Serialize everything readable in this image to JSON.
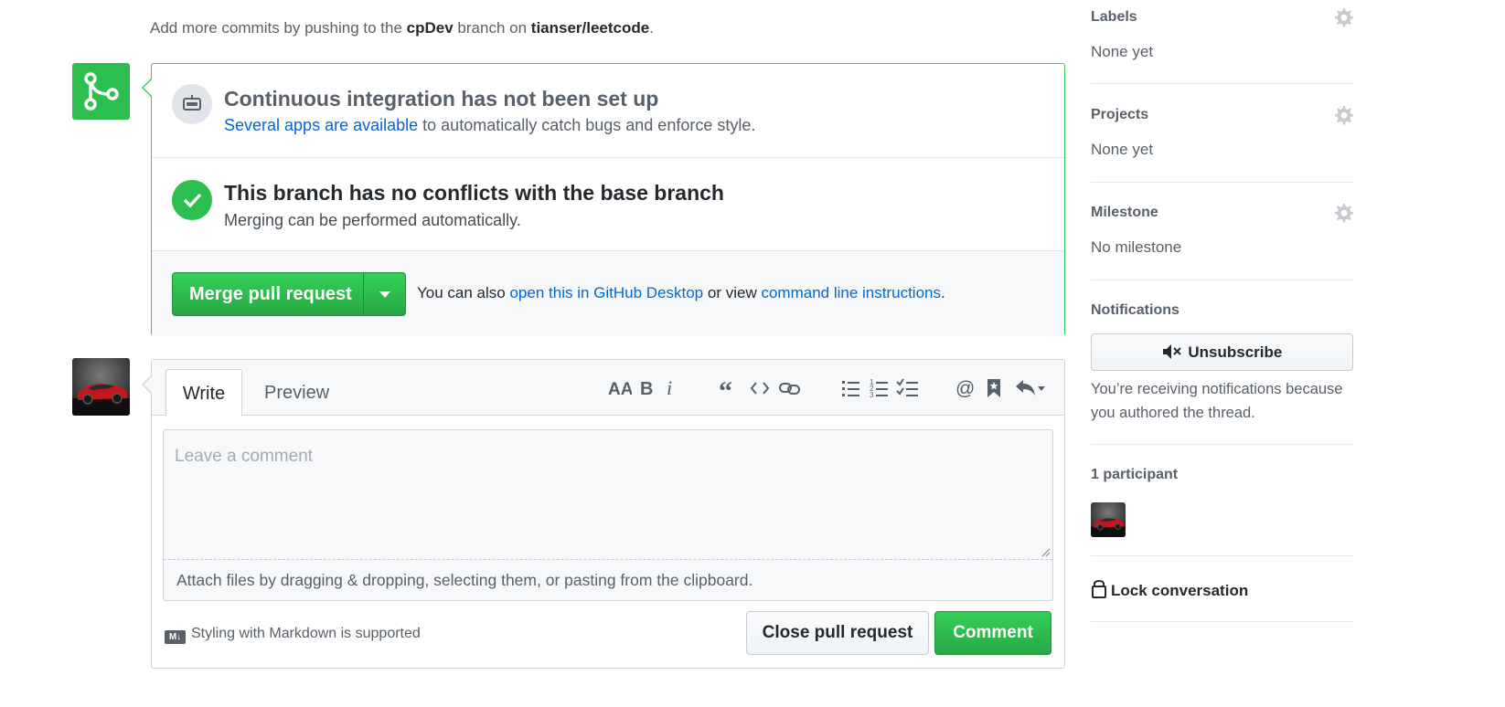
{
  "hint": {
    "prefix": "Add more commits by pushing to the",
    "branch": "cpDev",
    "middle": "branch on",
    "repo": "tianser/leetcode",
    "suffix": "."
  },
  "merge_box": {
    "ci_title": "Continuous integration has not been set up",
    "ci_link": "Several apps are available",
    "ci_rest": "to automatically catch bugs and enforce style.",
    "noconf_title": "This branch has no conflicts with the base branch",
    "noconf_sub": "Merging can be performed automatically.",
    "merge_button": "Merge pull request",
    "action_prefix": "You can also",
    "desktop_link": "open this in GitHub Desktop",
    "action_mid": "or view",
    "cli_link": "command line instructions",
    "action_suffix": "."
  },
  "comment": {
    "tabs": [
      "Write",
      "Preview"
    ],
    "toolbar": [
      "header-icon",
      "bold-icon",
      "italic-icon",
      "quote-icon",
      "code-icon",
      "link-icon",
      "bullet-list-icon",
      "numbered-list-icon",
      "task-list-icon",
      "mention-icon",
      "bookmark-icon",
      "reply-icon"
    ],
    "placeholder": "Leave a comment",
    "attach": "Attach files by dragging & dropping, selecting them, or pasting from the clipboard.",
    "markdown_note": "Styling with Markdown is supported",
    "close_button": "Close pull request",
    "comment_button": "Comment"
  },
  "sidebar": {
    "labels": {
      "title": "Labels",
      "value": "None yet"
    },
    "projects": {
      "title": "Projects",
      "value": "None yet"
    },
    "milestone": {
      "title": "Milestone",
      "value": "No milestone"
    },
    "notifications": {
      "title": "Notifications",
      "button": "Unsubscribe",
      "text": "You’re receiving notifications because you authored the thread."
    },
    "participants": {
      "title": "1 participant"
    },
    "lock": "Lock conversation"
  },
  "colors": {
    "green": "#2cbe4e",
    "link": "#0366d6",
    "muted": "#586069"
  }
}
